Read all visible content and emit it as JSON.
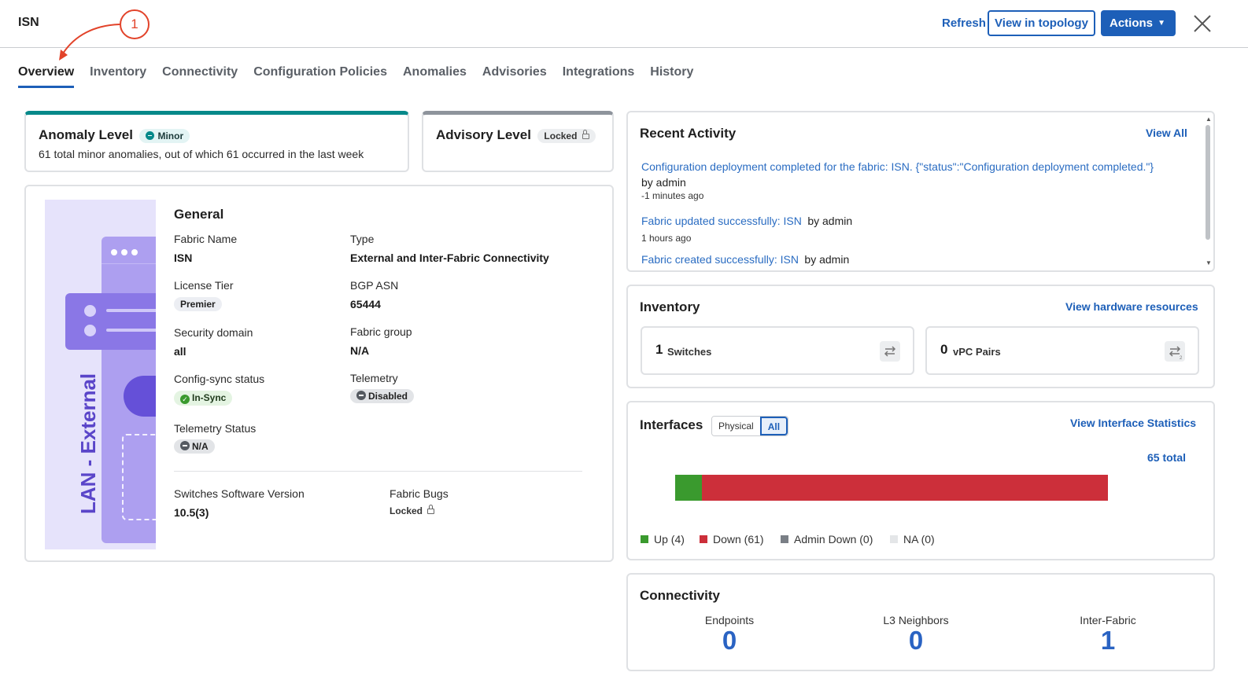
{
  "header": {
    "title": "ISN",
    "annotation_number": "1",
    "refresh_label": "Refresh",
    "topology_label": "View in topology",
    "actions_label": "Actions"
  },
  "tabs": [
    {
      "label": "Overview",
      "active": true
    },
    {
      "label": "Inventory"
    },
    {
      "label": "Connectivity"
    },
    {
      "label": "Configuration Policies"
    },
    {
      "label": "Anomalies"
    },
    {
      "label": "Advisories"
    },
    {
      "label": "Integrations"
    },
    {
      "label": "History"
    }
  ],
  "anomaly": {
    "title": "Anomaly Level",
    "badge": "Minor",
    "description": "61 total minor anomalies, out of which 61 occurred in the last week",
    "accent_color": "#06898a"
  },
  "advisory": {
    "title": "Advisory Level",
    "badge": "Locked"
  },
  "general": {
    "illustration_text": "LAN - External",
    "title": "General",
    "fabric_name_label": "Fabric Name",
    "fabric_name": "ISN",
    "type_label": "Type",
    "type": "External and Inter-Fabric Connectivity",
    "license_tier_label": "License Tier",
    "license_tier": "Premier",
    "bgp_asn_label": "BGP ASN",
    "bgp_asn": "65444",
    "security_domain_label": "Security domain",
    "security_domain": "all",
    "fabric_group_label": "Fabric group",
    "fabric_group": "N/A",
    "config_sync_label": "Config-sync status",
    "config_sync": "In-Sync",
    "telemetry_label": "Telemetry",
    "telemetry": "Disabled",
    "telemetry_status_label": "Telemetry Status",
    "telemetry_status": "N/A",
    "sw_version_label": "Switches Software Version",
    "sw_version": "10.5(3)",
    "fabric_bugs_label": "Fabric Bugs",
    "fabric_bugs": "Locked"
  },
  "recent_activity": {
    "title": "Recent Activity",
    "view_all": "View All",
    "items": [
      {
        "text": "Configuration deployment completed for the fabric: ISN. {\"status\":\"Configuration deployment completed.\"}",
        "by": "by admin",
        "time": "-1 minutes ago"
      },
      {
        "text": "Fabric updated successfully: ISN",
        "by": "by admin",
        "time": "1 hours ago"
      },
      {
        "text": "Fabric created successfully: ISN",
        "by": "by admin",
        "time": ""
      }
    ]
  },
  "inventory": {
    "title": "Inventory",
    "link": "View hardware resources",
    "switches_count": "1",
    "switches_label": "Switches",
    "vpc_count": "0",
    "vpc_label": "vPC Pairs"
  },
  "interfaces": {
    "title": "Interfaces",
    "toggle_physical": "Physical",
    "toggle_all": "All",
    "link": "View Interface Statistics",
    "total": "65 total",
    "up": 4,
    "down": 61,
    "admin_down": 0,
    "na": 0,
    "legend": {
      "up": "Up (4)",
      "down": "Down (61)",
      "admin_down": "Admin Down (0)",
      "na": "NA (0)"
    },
    "colors": {
      "up": "#3a9a2e",
      "down": "#cc2f3a",
      "admin_down": "#7a7f86",
      "na": "#e4e6e8"
    }
  },
  "connectivity": {
    "title": "Connectivity",
    "endpoints_label": "Endpoints",
    "endpoints": "0",
    "l3_label": "L3 Neighbors",
    "l3": "0",
    "inter_fabric_label": "Inter-Fabric",
    "inter_fabric": "1"
  }
}
